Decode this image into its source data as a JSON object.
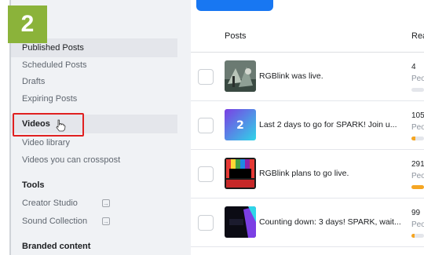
{
  "step": {
    "number": "2",
    "color": "#8bb33a"
  },
  "sidebar": {
    "items": [
      {
        "label": "Published Posts"
      },
      {
        "label": "Scheduled Posts"
      },
      {
        "label": "Drafts"
      },
      {
        "label": "Expiring Posts"
      },
      {
        "label": "Videos"
      },
      {
        "label": "Video library"
      },
      {
        "label": "Videos you can crosspost"
      },
      {
        "label": "Tools"
      },
      {
        "label": "Creator Studio"
      },
      {
        "label": "Sound Collection"
      },
      {
        "label": "Branded content"
      }
    ],
    "highlight_color": "#e02020"
  },
  "table": {
    "columns": [
      "Posts",
      "Rea"
    ],
    "rows": [
      {
        "title": "RGBlink was live.",
        "reach": "4",
        "sub": "Peo",
        "bar": 0.0
      },
      {
        "title": "Last 2 days to go for SPARK! Join u...",
        "reach": "105",
        "sub": "Peo",
        "bar": 0.3
      },
      {
        "title": "RGBlink plans to go live.",
        "reach": "291",
        "sub": "Peo",
        "bar": 1.0
      },
      {
        "title": "Counting down: 3 days! SPARK, wait...",
        "reach": "99",
        "sub": "Peo",
        "bar": 0.25
      }
    ]
  },
  "colors": {
    "accent": "#1877f2",
    "bar": "#f5a623"
  }
}
